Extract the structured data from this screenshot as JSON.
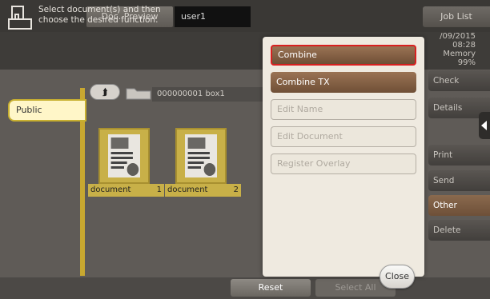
{
  "header": {
    "tab_doc_preview": "Doc. Preview",
    "user_name": "user1",
    "job_list": "Job List"
  },
  "message": {
    "line1": "Select document(s) and then",
    "line2": "choose the desired function."
  },
  "status": {
    "date": "/09/2015",
    "time": "08:28",
    "memory_label": "Memory",
    "memory_value": "99%"
  },
  "left_tab": {
    "label": "Public"
  },
  "box": {
    "up_glyph": "⮭",
    "label": "000000001  box1"
  },
  "documents": [
    {
      "name": "document",
      "number": "1"
    },
    {
      "name": "document",
      "number": "2"
    }
  ],
  "right_panel": {
    "items": [
      {
        "label": "Check Setting"
      },
      {
        "label": "Details"
      },
      {
        "label": "Print"
      },
      {
        "label": "Send"
      },
      {
        "label": "Other"
      },
      {
        "label": "Delete"
      }
    ],
    "active": "Other"
  },
  "popup": {
    "items": [
      {
        "label": "Combine",
        "state": "selected"
      },
      {
        "label": "Combine TX",
        "state": "enabled"
      },
      {
        "label": "Edit Name",
        "state": "disabled"
      },
      {
        "label": "Edit Document",
        "state": "disabled"
      },
      {
        "label": "Register Overlay",
        "state": "disabled"
      }
    ],
    "close_label": "Close"
  },
  "bottom": {
    "reset_label": "Reset",
    "select_all_label": "Select All"
  },
  "colors": {
    "accent_brown": "#8a6a4e",
    "selection_red": "#d82020",
    "public_yellow": "#c8b048"
  }
}
